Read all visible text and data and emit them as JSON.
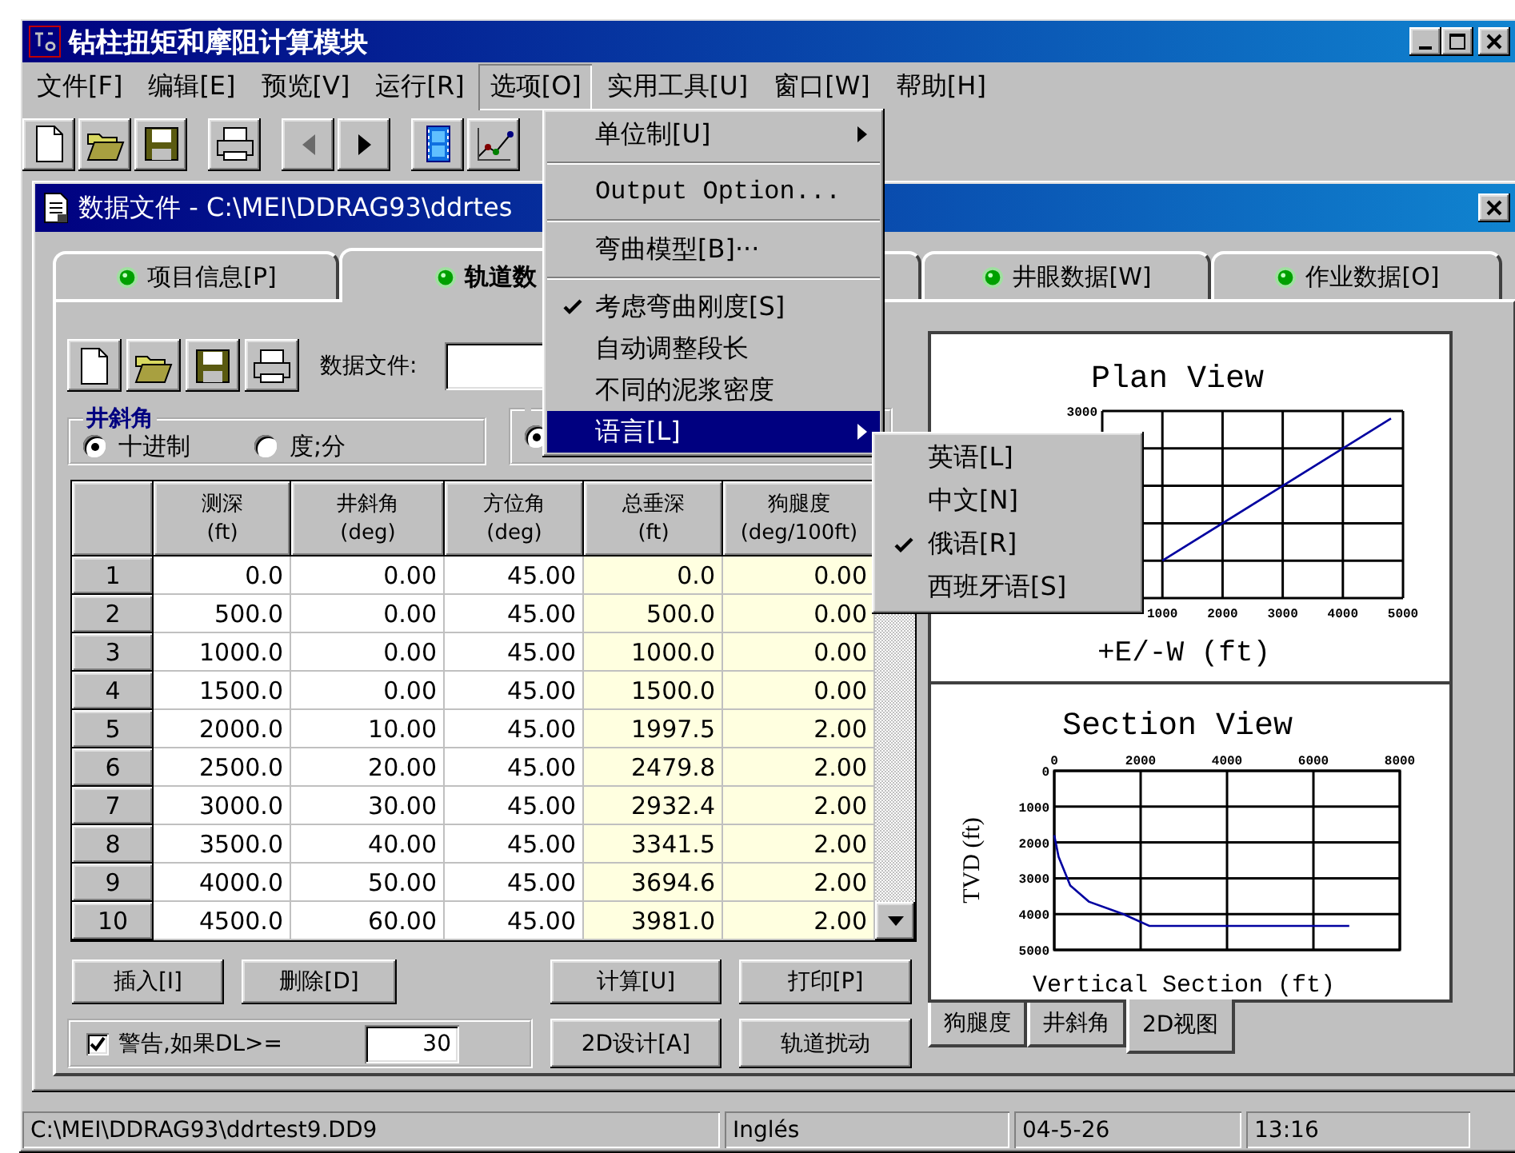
{
  "window": {
    "title": "钻柱扭矩和摩阻计算模块"
  },
  "menu_bar": [
    {
      "label": "文件[F]",
      "selected": false
    },
    {
      "label": "编辑[E]",
      "selected": false
    },
    {
      "label": "预览[V]",
      "selected": false
    },
    {
      "label": "运行[R]",
      "selected": false
    },
    {
      "label": "选项[O]",
      "selected": true
    },
    {
      "label": "实用工具[U]",
      "selected": false
    },
    {
      "label": "窗口[W]",
      "selected": false
    },
    {
      "label": "帮助[H]",
      "selected": false
    }
  ],
  "toolbar": [
    {
      "buttons": [
        {
          "kind": "new",
          "disabled": false
        },
        {
          "kind": "open",
          "disabled": false
        },
        {
          "kind": "save",
          "disabled": false
        }
      ]
    },
    {
      "buttons": [
        {
          "kind": "print",
          "disabled": false
        }
      ]
    },
    {
      "buttons": [
        {
          "kind": "back",
          "disabled": true
        },
        {
          "kind": "forward",
          "disabled": false
        }
      ]
    },
    {
      "buttons": [
        {
          "kind": "film",
          "disabled": false
        },
        {
          "kind": "chart",
          "disabled": false
        }
      ]
    }
  ],
  "options_menu": {
    "items": [
      {
        "kind": "item",
        "label": "单位制[U]",
        "submenu": true,
        "checked": false,
        "selected": false
      },
      {
        "kind": "separator"
      },
      {
        "kind": "item",
        "label": "Output Option...",
        "submenu": false,
        "checked": false,
        "selected": false,
        "latin": true
      },
      {
        "kind": "separator"
      },
      {
        "kind": "item",
        "label": "弯曲模型[B]···",
        "submenu": false,
        "checked": false,
        "selected": false
      },
      {
        "kind": "separator"
      },
      {
        "kind": "item",
        "label": "考虑弯曲刚度[S]",
        "submenu": false,
        "checked": true,
        "selected": false
      },
      {
        "kind": "item",
        "label": "自动调整段长",
        "submenu": false,
        "checked": false,
        "selected": false
      },
      {
        "kind": "item",
        "label": "不同的泥浆密度",
        "submenu": false,
        "checked": false,
        "selected": false
      },
      {
        "kind": "item",
        "label": "语言[L]",
        "submenu": true,
        "checked": false,
        "selected": true
      }
    ]
  },
  "language_submenu": {
    "items": [
      {
        "label": "英语[L]",
        "checked": false
      },
      {
        "label": "中文[N]",
        "checked": false
      },
      {
        "label": "俄语[R]",
        "checked": true
      },
      {
        "label": "西班牙语[S]",
        "checked": false
      }
    ]
  },
  "document_window": {
    "title": "数据文件 - C:\\MEI\\DDRAG93\\ddrtes"
  },
  "tabs": [
    {
      "label": "项目信息[P]",
      "selected": false
    },
    {
      "label": "轨道数",
      "selected": true
    },
    {
      "label": "井眼数据[W]",
      "selected": false
    },
    {
      "label": "作业数据[O]",
      "selected": false
    }
  ],
  "data_file": {
    "label": "数据文件:"
  },
  "inclination_units": {
    "title": "井斜角",
    "options": [
      {
        "label": "十进制",
        "selected": true
      },
      {
        "label": "度;分",
        "selected": false
      }
    ]
  },
  "azimuth_units": {
    "options": [
      {
        "selected": true
      }
    ]
  },
  "survey_table": {
    "columns": [
      {
        "name": "测深",
        "unit": "(ft)",
        "computed": false
      },
      {
        "name": "井斜角",
        "unit": "(deg)",
        "computed": false
      },
      {
        "name": "方位角",
        "unit": "(deg)",
        "computed": false
      },
      {
        "name": "总垂深",
        "unit": "(ft)",
        "computed": true
      },
      {
        "name": "狗腿度",
        "unit": "(deg/100ft)",
        "computed": true
      }
    ],
    "rows": [
      {
        "index": "1",
        "cells": [
          "0.0",
          "0.00",
          "45.00",
          "0.0",
          "0.00"
        ]
      },
      {
        "index": "2",
        "cells": [
          "500.0",
          "0.00",
          "45.00",
          "500.0",
          "0.00"
        ]
      },
      {
        "index": "3",
        "cells": [
          "1000.0",
          "0.00",
          "45.00",
          "1000.0",
          "0.00"
        ]
      },
      {
        "index": "4",
        "cells": [
          "1500.0",
          "0.00",
          "45.00",
          "1500.0",
          "0.00"
        ]
      },
      {
        "index": "5",
        "cells": [
          "2000.0",
          "10.00",
          "45.00",
          "1997.5",
          "2.00"
        ]
      },
      {
        "index": "6",
        "cells": [
          "2500.0",
          "20.00",
          "45.00",
          "2479.8",
          "2.00"
        ]
      },
      {
        "index": "7",
        "cells": [
          "3000.0",
          "30.00",
          "45.00",
          "2932.4",
          "2.00"
        ]
      },
      {
        "index": "8",
        "cells": [
          "3500.0",
          "40.00",
          "45.00",
          "3341.5",
          "2.00"
        ]
      },
      {
        "index": "9",
        "cells": [
          "4000.0",
          "50.00",
          "45.00",
          "3694.6",
          "2.00"
        ]
      },
      {
        "index": "10",
        "cells": [
          "4500.0",
          "60.00",
          "45.00",
          "3981.0",
          "2.00"
        ]
      }
    ]
  },
  "row_buttons": [
    "插入[I]",
    "删除[D]"
  ],
  "action_buttons": [
    "计算[U]",
    "打印[P]"
  ],
  "warning": {
    "label": "警告,如果DL>=",
    "checked": true,
    "value": "30"
  },
  "design_buttons": [
    "2D设计[A]",
    "轨道扰动"
  ],
  "plan_view": {
    "title": "Plan View",
    "xlabel": "+E/-W (ft)",
    "y_tick_labels": [
      "3000"
    ],
    "x_tick_labels": [
      "1000",
      "2000",
      "3000",
      "4000",
      "5000"
    ]
  },
  "section_view": {
    "chart_data": {
      "type": "line",
      "title": "Section View",
      "xlabel": "Vertical Section (ft)",
      "ylabel": "TVD (ft)",
      "xlim": [
        0,
        8000
      ],
      "ylim": [
        5000,
        0
      ],
      "grid": true,
      "xticks": [
        0,
        2000,
        4000,
        6000,
        8000
      ],
      "yticks": [
        0,
        1000,
        2000,
        3000,
        4000,
        5000
      ],
      "x": [
        0,
        100,
        370,
        800,
        1600,
        2200,
        4000,
        6830
      ],
      "series": [
        {
          "color": "#0000a0",
          "values": [
            1800,
            2400,
            3200,
            3650,
            4000,
            4330,
            4330,
            4330
          ]
        }
      ]
    }
  },
  "view_tabs": [
    {
      "label": "狗腿度",
      "selected": false
    },
    {
      "label": "井斜角",
      "selected": false
    },
    {
      "label": "2D视图",
      "selected": true
    }
  ],
  "status_bar": [
    "C:\\MEI\\DDRAG93\\ddrtest9.DD9",
    "Inglés",
    "04-5-26",
    "13:16"
  ]
}
